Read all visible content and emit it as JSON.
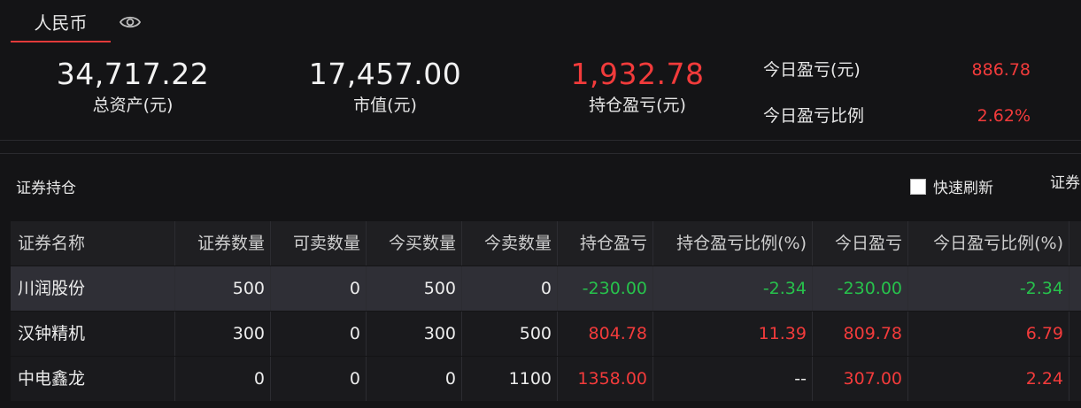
{
  "tabs": {
    "active": "人民币"
  },
  "summary": {
    "total_assets": {
      "value": "34,717.22",
      "label": "总资产(元)"
    },
    "market_value": {
      "value": "17,457.00",
      "label": "市值(元)"
    },
    "position_pnl": {
      "value": "1,932.78",
      "label": "持仓盈亏(元)"
    },
    "today_pnl": {
      "label": "今日盈亏(元)",
      "value": "886.78"
    },
    "today_pnl_ratio": {
      "label": "今日盈亏比例",
      "value": "2.62%"
    }
  },
  "positions": {
    "title": "证券持仓",
    "quick_refresh_label": "快速刷新",
    "cut_label": "证券",
    "columns": [
      "证券名称",
      "证券数量",
      "可卖数量",
      "今买数量",
      "今卖数量",
      "持仓盈亏",
      "持仓盈亏比例(%)",
      "今日盈亏",
      "今日盈亏比例(%)"
    ],
    "rows": [
      {
        "name": "川润股份",
        "qty": "500",
        "sellable": "0",
        "buy_today": "500",
        "sell_today": "0",
        "pnl": "-230.00",
        "pnl_ratio": "-2.34",
        "today_pnl": "-230.00",
        "today_ratio": "-2.34"
      },
      {
        "name": "汉钟精机",
        "qty": "300",
        "sellable": "0",
        "buy_today": "300",
        "sell_today": "500",
        "pnl": "804.78",
        "pnl_ratio": "11.39",
        "today_pnl": "809.78",
        "today_ratio": "6.79"
      },
      {
        "name": "中电鑫龙",
        "qty": "0",
        "sellable": "0",
        "buy_today": "0",
        "sell_today": "1100",
        "pnl": "1358.00",
        "pnl_ratio": "--",
        "today_pnl": "307.00",
        "today_ratio": "2.24"
      }
    ]
  },
  "colors": {
    "accent_red": "#f23b3b",
    "gain_green": "#27c24c",
    "background": "#141416"
  },
  "icons": {
    "visibility": "eye-icon"
  }
}
